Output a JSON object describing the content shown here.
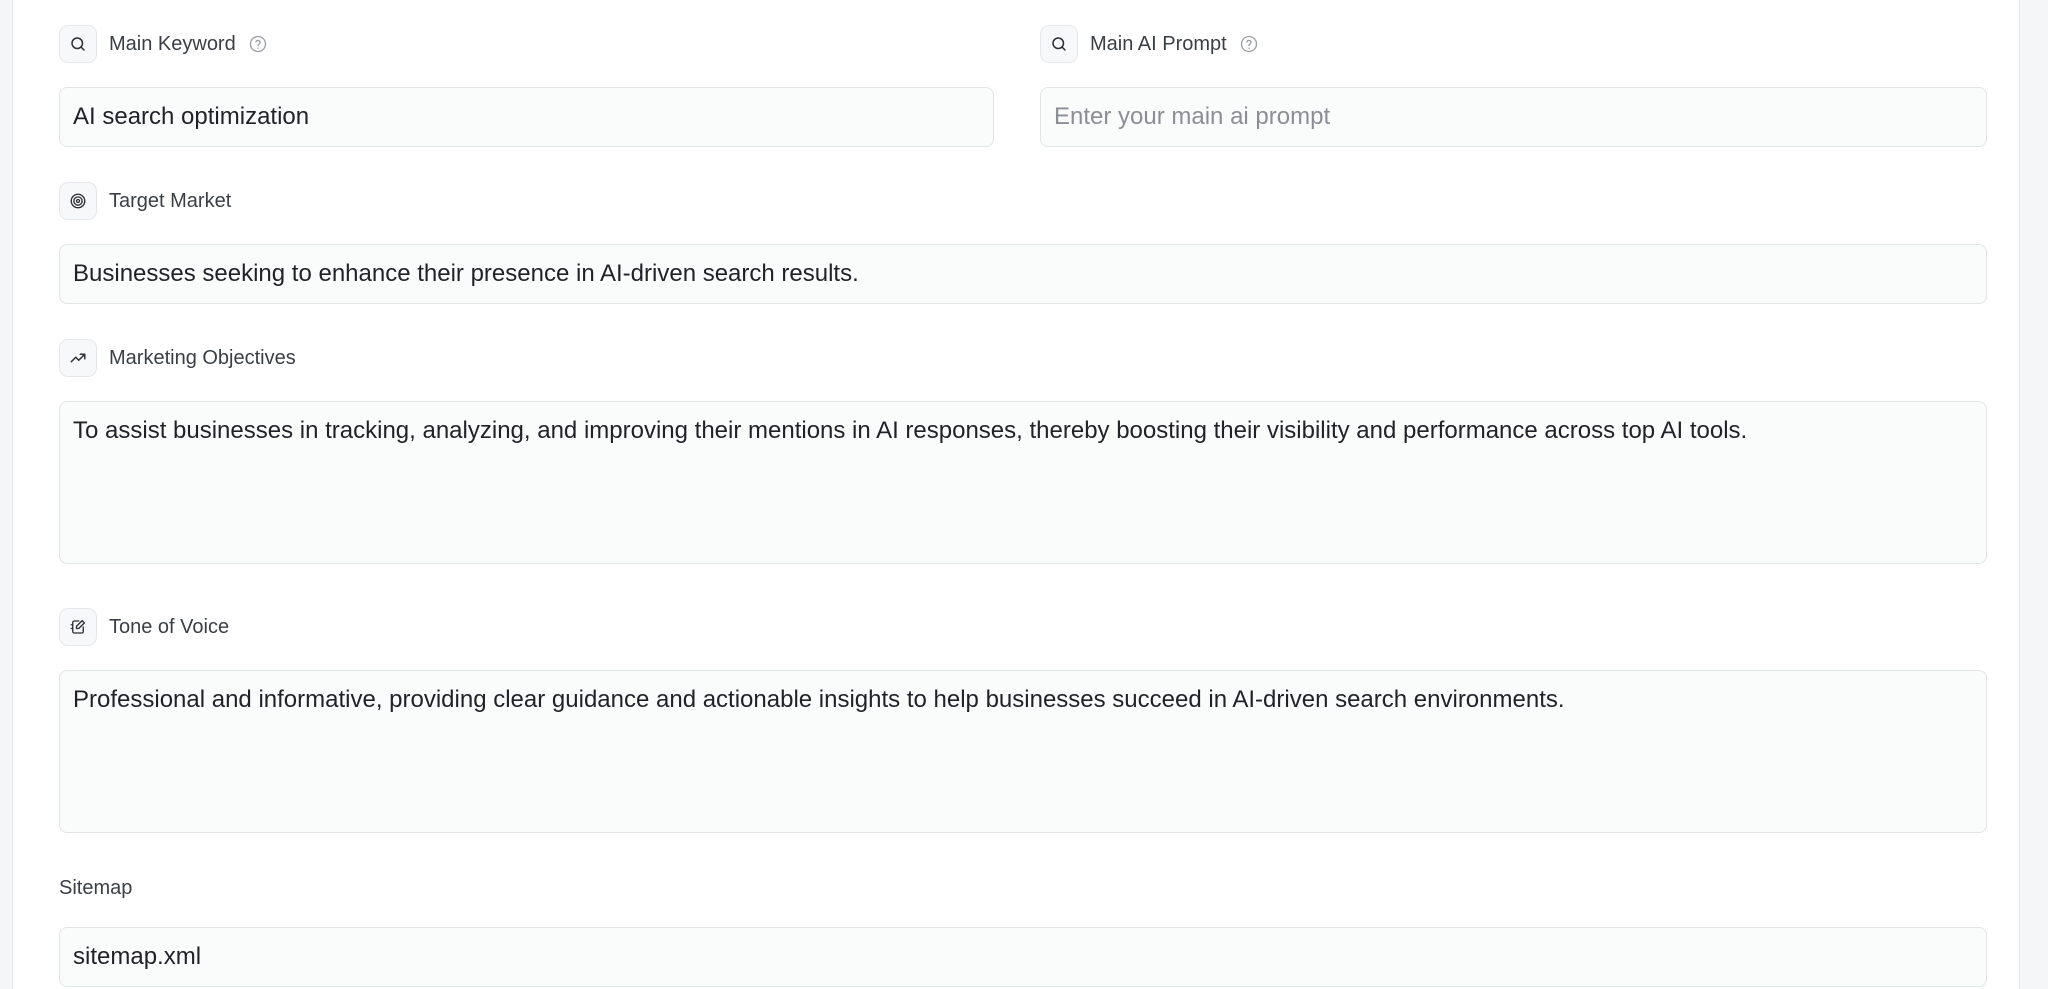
{
  "main_keyword": {
    "label": "Main Keyword",
    "value": "AI search optimization"
  },
  "main_ai_prompt": {
    "label": "Main AI Prompt",
    "placeholder": "Enter your main ai prompt",
    "value": ""
  },
  "target_market": {
    "label": "Target Market",
    "value": "Businesses seeking to enhance their presence in AI-driven search results."
  },
  "marketing_objectives": {
    "label": "Marketing Objectives",
    "value": "To assist businesses in tracking, analyzing, and improving their mentions in AI responses, thereby boosting their visibility and performance across top AI tools."
  },
  "tone_of_voice": {
    "label": "Tone of Voice",
    "value": "Professional and informative, providing clear guidance and actionable insights to help businesses succeed in AI-driven search environments."
  },
  "sitemap": {
    "label": "Sitemap",
    "value": "sitemap.xml"
  },
  "icons": {
    "main_keyword": "search-icon",
    "main_ai_prompt": "search-icon",
    "help": "question-circle-icon",
    "target_market": "target-icon",
    "marketing_objectives": "trending-up-icon",
    "tone_of_voice": "edit-note-icon"
  }
}
